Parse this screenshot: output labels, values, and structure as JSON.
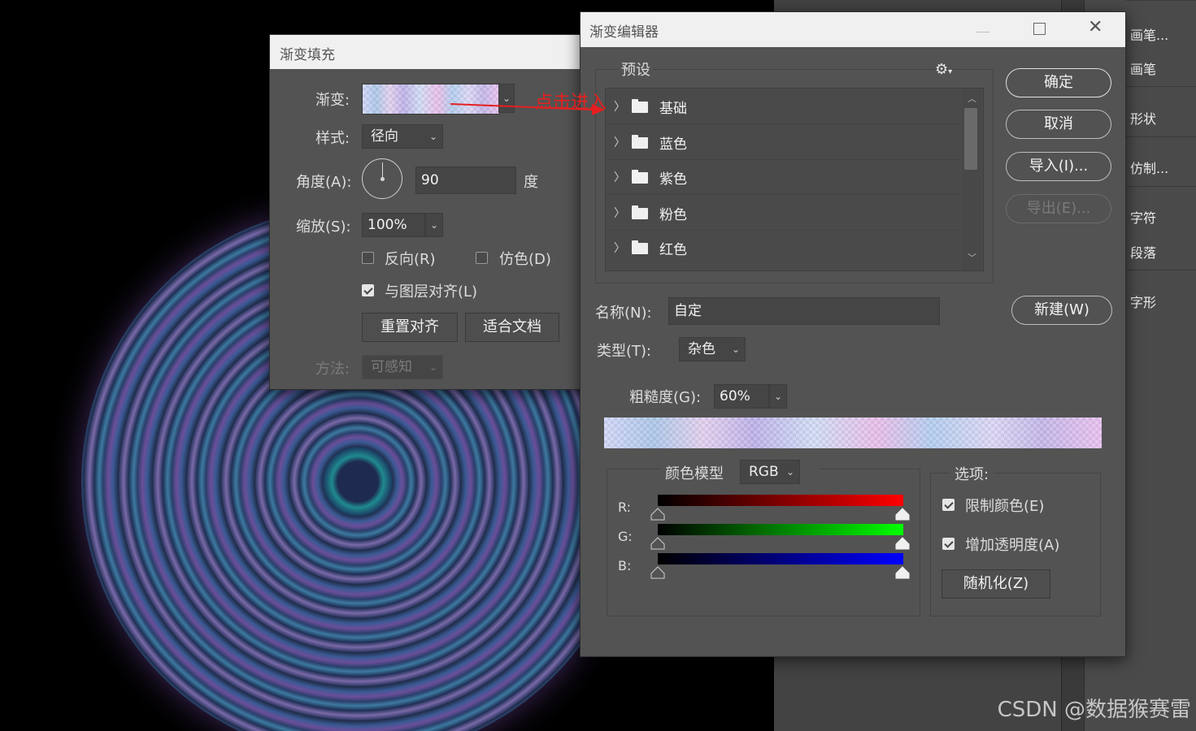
{
  "side_panel": {
    "items": [
      "画笔...",
      "画笔",
      "形状",
      "仿制...",
      "字符",
      "段落",
      "字形"
    ]
  },
  "watermark": "CSDN @数据猴赛雷",
  "annotation": "点击进入",
  "fill_dialog": {
    "title": "渐变填充",
    "gradient_label": "渐变:",
    "style_label": "样式:",
    "style_value": "径向",
    "angle_label": "角度(A):",
    "angle_value": "90",
    "angle_unit": "度",
    "scale_label": "缩放(S):",
    "scale_value": "100%",
    "reverse_label": "反向(R)",
    "dither_label": "仿色(D)",
    "align_label": "与图层对齐(L)",
    "reset_align_label": "重置对齐",
    "fit_doc_label": "适合文档",
    "method_label": "方法:",
    "method_value": "可感知"
  },
  "editor": {
    "title": "渐变编辑器",
    "presets_label": "预设",
    "preset_folders": [
      "基础",
      "蓝色",
      "紫色",
      "粉色",
      "红色"
    ],
    "ok_label": "确定",
    "cancel_label": "取消",
    "import_label": "导入(I)...",
    "export_label": "导出(E)...",
    "name_label": "名称(N):",
    "name_value": "自定",
    "new_label": "新建(W)",
    "type_label": "类型(T):",
    "type_value": "杂色",
    "roughness_label": "粗糙度(G):",
    "roughness_value": "60%",
    "color_model_label": "颜色模型",
    "color_model_value": "RGB",
    "channels": [
      "R:",
      "G:",
      "B:"
    ],
    "options_label": "选项:",
    "restrict_label": "限制颜色(E)",
    "add_transparency_label": "增加透明度(A)",
    "randomize_label": "随机化(Z)"
  }
}
